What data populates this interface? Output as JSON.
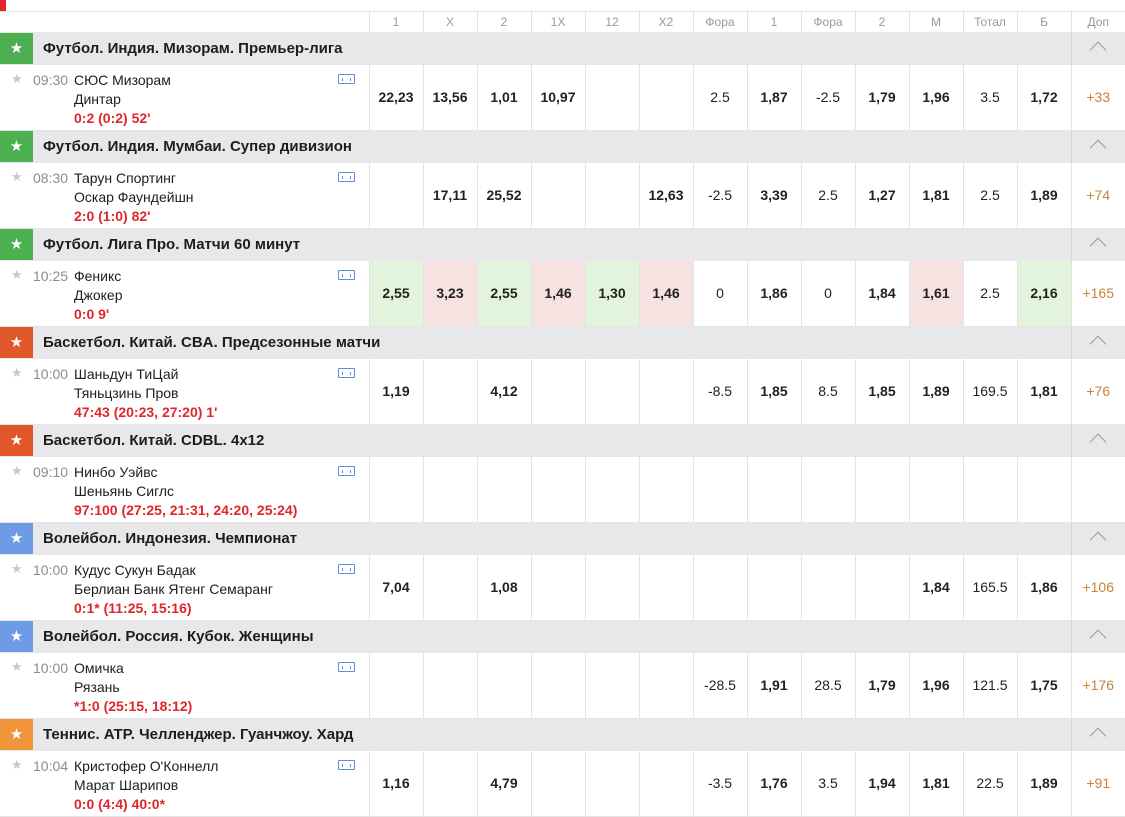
{
  "columns": [
    "1",
    "X",
    "2",
    "1X",
    "12",
    "X2",
    "Фора",
    "1",
    "Фора",
    "2",
    "М",
    "Тотал",
    "Б",
    "Доп"
  ],
  "colors": {
    "football": "#4caf50",
    "basketball": "#e0572a",
    "volleyball": "#6f9be6",
    "tennis": "#f0953a",
    "score": "#e0262b",
    "plus": "#c8823a"
  },
  "sections": [
    {
      "sport": "football",
      "title": "Футбол. Индия. Мизорам. Премьер-лига",
      "event": {
        "time": "09:30",
        "team1": "СЮС Мизорам",
        "team2": "Динтар",
        "score": "0:2 (0:2) 52'",
        "odds": [
          [
            "22,23",
            "b",
            ""
          ],
          [
            "13,56",
            "b",
            ""
          ],
          [
            "1,01",
            "b",
            ""
          ],
          [
            "10,97",
            "b",
            ""
          ],
          [
            "",
            "",
            ""
          ],
          [
            "",
            "",
            ""
          ],
          [
            "2.5",
            "",
            ""
          ],
          [
            "1,87",
            "b",
            ""
          ],
          [
            "-2.5",
            "",
            ""
          ],
          [
            "1,79",
            "b",
            ""
          ],
          [
            "1,96",
            "b",
            ""
          ],
          [
            "3.5",
            "",
            ""
          ],
          [
            "1,72",
            "b",
            ""
          ]
        ],
        "plus": "+33"
      }
    },
    {
      "sport": "football",
      "title": "Футбол. Индия. Мумбаи. Супер дивизион",
      "event": {
        "time": "08:30",
        "team1": "Тарун Спортинг",
        "team2": "Оскар Фаундейшн",
        "score": "2:0 (1:0) 82'",
        "odds": [
          [
            "",
            "",
            ""
          ],
          [
            "17,11",
            "b",
            ""
          ],
          [
            "25,52",
            "b",
            ""
          ],
          [
            "",
            "",
            ""
          ],
          [
            "",
            "",
            ""
          ],
          [
            "12,63",
            "b",
            ""
          ],
          [
            "-2.5",
            "",
            ""
          ],
          [
            "3,39",
            "b",
            ""
          ],
          [
            "2.5",
            "",
            ""
          ],
          [
            "1,27",
            "b",
            ""
          ],
          [
            "1,81",
            "b",
            ""
          ],
          [
            "2.5",
            "",
            ""
          ],
          [
            "1,89",
            "b",
            ""
          ]
        ],
        "plus": "+74"
      }
    },
    {
      "sport": "football",
      "title": "Футбол. Лига Про. Матчи 60 минут",
      "event": {
        "time": "10:25",
        "team1": "Феникс",
        "team2": "Джокер",
        "score": "0:0 9'",
        "odds": [
          [
            "2,55",
            "b",
            "g"
          ],
          [
            "3,23",
            "b",
            "r"
          ],
          [
            "2,55",
            "b",
            "g"
          ],
          [
            "1,46",
            "b",
            "r"
          ],
          [
            "1,30",
            "b",
            "g"
          ],
          [
            "1,46",
            "b",
            "r"
          ],
          [
            "0",
            "",
            ""
          ],
          [
            "1,86",
            "b",
            ""
          ],
          [
            "0",
            "",
            ""
          ],
          [
            "1,84",
            "b",
            ""
          ],
          [
            "1,61",
            "b",
            "r"
          ],
          [
            "2.5",
            "",
            ""
          ],
          [
            "2,16",
            "b",
            "g"
          ]
        ],
        "plus": "+165"
      }
    },
    {
      "sport": "basketball",
      "title": "Баскетбол. Китай. CBA. Предсезонные матчи",
      "event": {
        "time": "10:00",
        "team1": "Шаньдун ТиЦай",
        "team2": "Тяньцзинь Пров",
        "score": "47:43 (20:23, 27:20) 1'",
        "odds": [
          [
            "1,19",
            "b",
            ""
          ],
          [
            "",
            "",
            ""
          ],
          [
            "4,12",
            "b",
            ""
          ],
          [
            "",
            "",
            ""
          ],
          [
            "",
            "",
            ""
          ],
          [
            "",
            "",
            ""
          ],
          [
            "-8.5",
            "",
            ""
          ],
          [
            "1,85",
            "b",
            ""
          ],
          [
            "8.5",
            "",
            ""
          ],
          [
            "1,85",
            "b",
            ""
          ],
          [
            "1,89",
            "b",
            ""
          ],
          [
            "169.5",
            "",
            ""
          ],
          [
            "1,81",
            "b",
            ""
          ]
        ],
        "plus": "+76"
      }
    },
    {
      "sport": "basketball",
      "title": "Баскетбол. Китай. CDBL. 4x12",
      "event": {
        "time": "09:10",
        "team1": "Нинбо Уэйвс",
        "team2": "Шеньянь Сиглс",
        "score": "97:100 (27:25, 21:31, 24:20, 25:24)",
        "odds": [
          [
            "",
            "",
            ""
          ],
          [
            "",
            "",
            ""
          ],
          [
            "",
            "",
            ""
          ],
          [
            "",
            "",
            ""
          ],
          [
            "",
            "",
            ""
          ],
          [
            "",
            "",
            ""
          ],
          [
            "",
            "",
            ""
          ],
          [
            "",
            "",
            ""
          ],
          [
            "",
            "",
            ""
          ],
          [
            "",
            "",
            ""
          ],
          [
            "",
            "",
            ""
          ],
          [
            "",
            "",
            ""
          ],
          [
            "",
            "",
            ""
          ]
        ],
        "plus": ""
      }
    },
    {
      "sport": "volleyball",
      "title": "Волейбол. Индонезия. Чемпионат",
      "event": {
        "time": "10:00",
        "team1": "Кудус Сукун Бадак",
        "team2": "Берлиан Банк Ятенг Семаранг",
        "score": "0:1* (11:25, 15:16)",
        "odds": [
          [
            "7,04",
            "b",
            ""
          ],
          [
            "",
            "",
            ""
          ],
          [
            "1,08",
            "b",
            ""
          ],
          [
            "",
            "",
            ""
          ],
          [
            "",
            "",
            ""
          ],
          [
            "",
            "",
            ""
          ],
          [
            "",
            "",
            ""
          ],
          [
            "",
            "",
            ""
          ],
          [
            "",
            "",
            ""
          ],
          [
            "",
            "",
            ""
          ],
          [
            "1,84",
            "b",
            ""
          ],
          [
            "165.5",
            "",
            ""
          ],
          [
            "1,86",
            "b",
            ""
          ]
        ],
        "plus": "+106"
      }
    },
    {
      "sport": "volleyball",
      "title": "Волейбол. Россия. Кубок. Женщины",
      "event": {
        "time": "10:00",
        "team1": "Омичка",
        "team2": "Рязань",
        "score": "*1:0 (25:15, 18:12)",
        "odds": [
          [
            "",
            "",
            ""
          ],
          [
            "",
            "",
            ""
          ],
          [
            "",
            "",
            ""
          ],
          [
            "",
            "",
            ""
          ],
          [
            "",
            "",
            ""
          ],
          [
            "",
            "",
            ""
          ],
          [
            "-28.5",
            "",
            ""
          ],
          [
            "1,91",
            "b",
            ""
          ],
          [
            "28.5",
            "",
            ""
          ],
          [
            "1,79",
            "b",
            ""
          ],
          [
            "1,96",
            "b",
            ""
          ],
          [
            "121.5",
            "",
            ""
          ],
          [
            "1,75",
            "b",
            ""
          ]
        ],
        "plus": "+176"
      }
    },
    {
      "sport": "tennis",
      "title": "Теннис. ATP. Челленджер. Гуанчжоу. Хард",
      "event": {
        "time": "10:04",
        "team1": "Кристофер О'Коннелл",
        "team2": "Марат Шарипов",
        "score": "0:0 (4:4) 40:0*",
        "odds": [
          [
            "1,16",
            "b",
            ""
          ],
          [
            "",
            "",
            ""
          ],
          [
            "4,79",
            "b",
            ""
          ],
          [
            "",
            "",
            ""
          ],
          [
            "",
            "",
            ""
          ],
          [
            "",
            "",
            ""
          ],
          [
            "-3.5",
            "",
            ""
          ],
          [
            "1,76",
            "b",
            ""
          ],
          [
            "3.5",
            "",
            ""
          ],
          [
            "1,94",
            "b",
            ""
          ],
          [
            "1,81",
            "b",
            ""
          ],
          [
            "22.5",
            "",
            ""
          ],
          [
            "1,89",
            "b",
            ""
          ]
        ],
        "plus": "+91"
      }
    }
  ]
}
